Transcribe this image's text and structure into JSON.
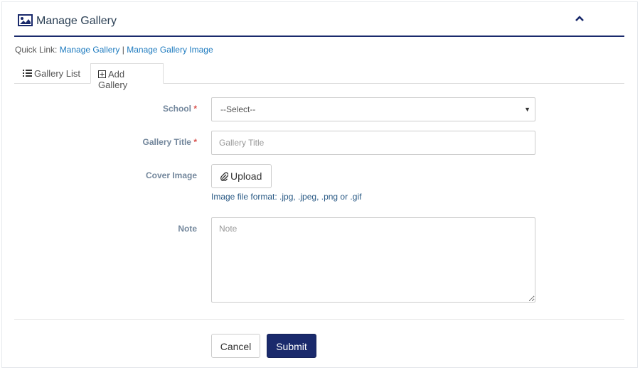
{
  "header": {
    "title": "Manage Gallery",
    "title_icon": "image-icon",
    "collapse_icon": "chevron-up-icon"
  },
  "quick_link": {
    "prefix": "Quick Link:",
    "link1": "Manage Gallery",
    "separator": "|",
    "link2": "Manage Gallery Image"
  },
  "tabs": [
    {
      "label": "Gallery List",
      "icon": "list-icon",
      "active": false
    },
    {
      "label": "Add Gallery",
      "icon": "plus-square-icon",
      "active": true
    }
  ],
  "form": {
    "school": {
      "label": "School",
      "required_mark": "*",
      "selected": "--Select--"
    },
    "gallery_title": {
      "label": "Gallery Title",
      "required_mark": "*",
      "placeholder": "Gallery Title",
      "value": ""
    },
    "cover_image": {
      "label": "Cover Image",
      "upload_label": "Upload",
      "upload_icon": "paperclip-icon",
      "hint": "Image file format: .jpg, .jpeg, .png or .gif"
    },
    "note": {
      "label": "Note",
      "placeholder": "Note",
      "value": ""
    }
  },
  "buttons": {
    "cancel": "Cancel",
    "submit": "Submit"
  },
  "colors": {
    "primary": "#1a2a6c",
    "link": "#1e7bbf",
    "label": "#73879c",
    "required": "#d9534f"
  }
}
